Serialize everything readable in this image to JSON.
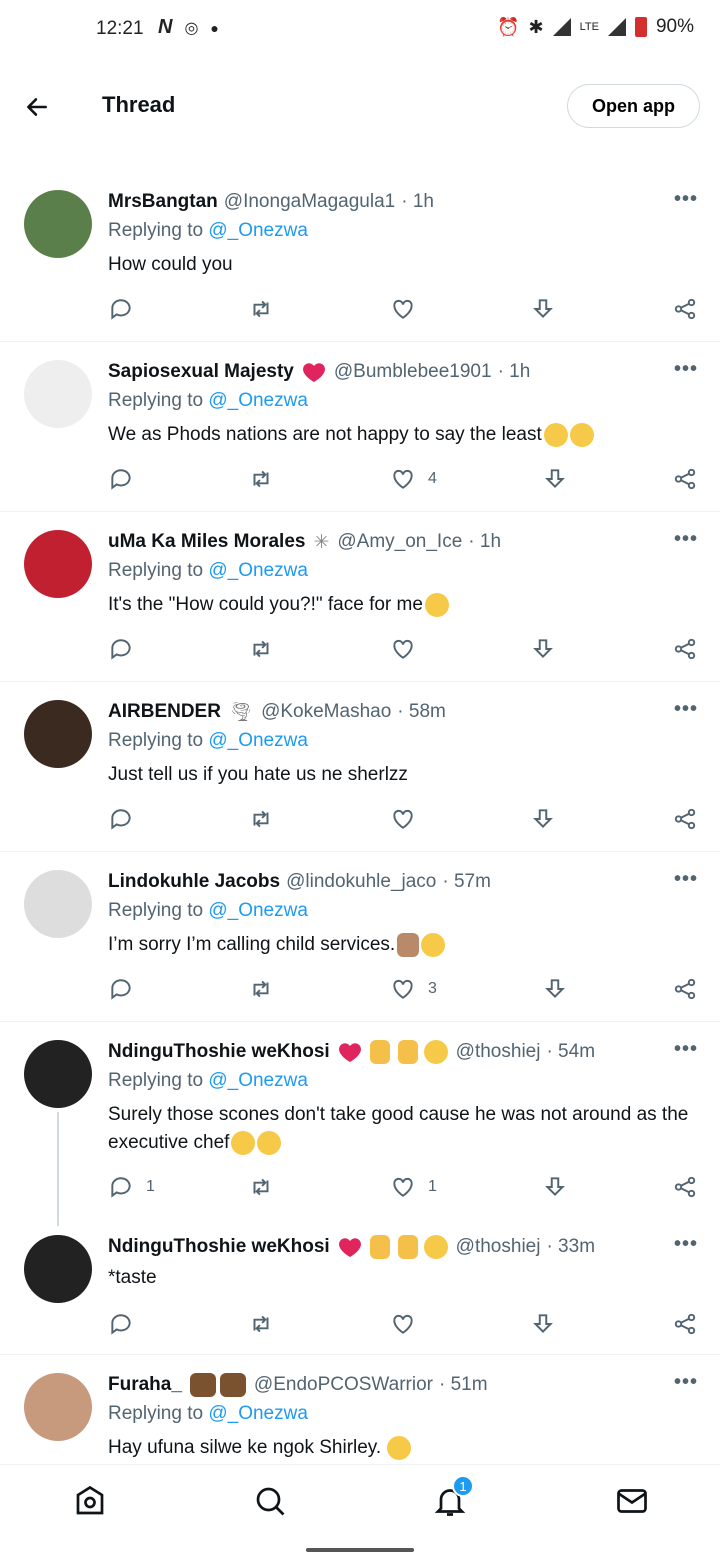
{
  "status_bar": {
    "time": "12:21",
    "network": "LTE",
    "battery": "90%"
  },
  "header": {
    "title": "Thread",
    "open_app": "Open app",
    "back_icon": "arrow-left-icon"
  },
  "tweets": [
    {
      "name": "MrsBangtan",
      "handle": "@InongaMagagula1",
      "time": "· 1h",
      "replying_prefix": "Replying to",
      "replying_to": "@_Onezwa",
      "text": "How could you",
      "replies": "",
      "retweets": "",
      "likes": ""
    },
    {
      "name": "Sapiosexual Majesty",
      "handle": "@Bumblebee1901",
      "time": "· 1h",
      "replying_prefix": "Replying to",
      "replying_to": "@_Onezwa",
      "text": "We as Phods nations are not happy to say the least",
      "replies": "",
      "retweets": "",
      "likes": "4"
    },
    {
      "name": "uMa Ka Miles Morales",
      "handle": "@Amy_on_Ice",
      "time": "· 1h",
      "replying_prefix": "Replying to",
      "replying_to": "@_Onezwa",
      "text": "It's the \"How could you?!\" face for me",
      "replies": "",
      "retweets": "",
      "likes": ""
    },
    {
      "name": "AIRBENDER",
      "handle": "@KokeMashao",
      "time": "· 58m",
      "replying_prefix": "Replying to",
      "replying_to": "@_Onezwa",
      "text": "Just tell us if you hate us ne sherlzz",
      "replies": "",
      "retweets": "",
      "likes": ""
    },
    {
      "name": "Lindokuhle Jacobs",
      "handle": "@lindokuhle_jaco",
      "time": "· 57m",
      "replying_prefix": "Replying to",
      "replying_to": "@_Onezwa",
      "text": "I’m sorry I’m calling child services.",
      "replies": "",
      "retweets": "",
      "likes": "3"
    },
    {
      "name": "NdinguThoshie weKhosi",
      "handle": "@thoshiej",
      "time": "· 54m",
      "replying_prefix": "Replying to",
      "replying_to": "@_Onezwa",
      "text": "Surely those scones don't take good cause he was not around as the executive chef",
      "replies": "1",
      "retweets": "",
      "likes": "1"
    },
    {
      "name": "NdinguThoshie weKhosi",
      "handle": "@thoshiej",
      "time": "· 33m",
      "replying_prefix": "",
      "replying_to": "",
      "text": "*taste",
      "replies": "",
      "retweets": "",
      "likes": ""
    },
    {
      "name": "Furaha_",
      "handle": "@EndoPCOSWarrior",
      "time": "· 51m",
      "replying_prefix": "Replying to",
      "replying_to": "@_Onezwa",
      "text": "Hay ufuna silwe ke ngok Shirley.",
      "replies": "",
      "retweets": "",
      "likes": ""
    }
  ],
  "bottom_nav": {
    "notifications_badge": "1",
    "icons": [
      "home-icon",
      "search-icon",
      "notifications-icon",
      "messages-icon"
    ]
  },
  "colors": {
    "accent": "#1d9bf0",
    "secondary_text": "#536471",
    "divider": "#eff3f4"
  }
}
